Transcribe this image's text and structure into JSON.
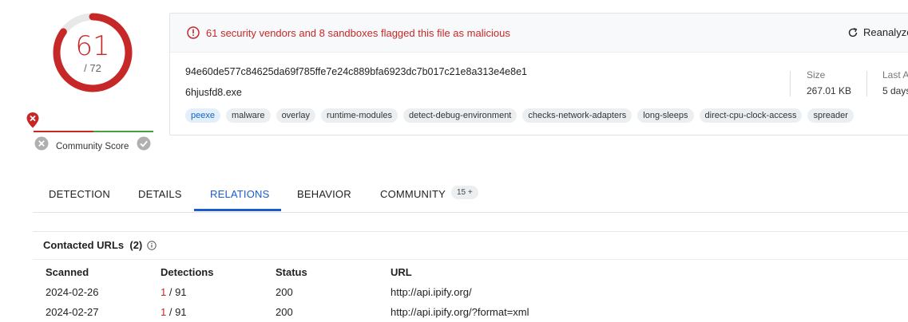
{
  "score": {
    "detections": "61",
    "total": "/ 72",
    "ratio": 0.847
  },
  "community": {
    "label": "Community Score"
  },
  "alert": {
    "text": "61 security vendors and 8 sandboxes flagged this file as malicious",
    "reanalyze": "Reanalyze"
  },
  "file": {
    "hash": "94e60de577c84625da69f785ffe7e24c889bfa6923dc7b017c21e8a313e4e8e1",
    "name": "6hjusfd8.exe",
    "tags": [
      "peexe",
      "malware",
      "overlay",
      "runtime-modules",
      "detect-debug-environment",
      "checks-network-adapters",
      "long-sleeps",
      "direct-cpu-clock-access",
      "spreader"
    ]
  },
  "meta": {
    "size_label": "Size",
    "size_value": "267.01 KB",
    "last_label": "Last A",
    "last_value": "5 days"
  },
  "tabs": [
    {
      "label": "DETECTION"
    },
    {
      "label": "DETAILS"
    },
    {
      "label": "RELATIONS"
    },
    {
      "label": "BEHAVIOR"
    },
    {
      "label": "COMMUNITY"
    }
  ],
  "community_badge": "15 +",
  "section": {
    "title": "Contacted URLs",
    "count": "(2)"
  },
  "table": {
    "headers": [
      "Scanned",
      "Detections",
      "Status",
      "URL"
    ],
    "rows": [
      {
        "scanned": "2024-02-26",
        "det_hit": "1",
        "det_total": " / 91",
        "status": "200",
        "url": "http://api.ipify.org/"
      },
      {
        "scanned": "2024-02-27",
        "det_hit": "1",
        "det_total": " / 91",
        "status": "200",
        "url": "http://api.ipify.org/?format=xml"
      }
    ]
  },
  "colors": {
    "malicious": "#c62828",
    "harmless": "#43a047",
    "accent": "#1a5cd0"
  },
  "icons": [
    "alert-circle-icon",
    "refresh-icon",
    "map-pin-icon",
    "close-circle-icon",
    "check-circle-icon",
    "info-icon"
  ]
}
